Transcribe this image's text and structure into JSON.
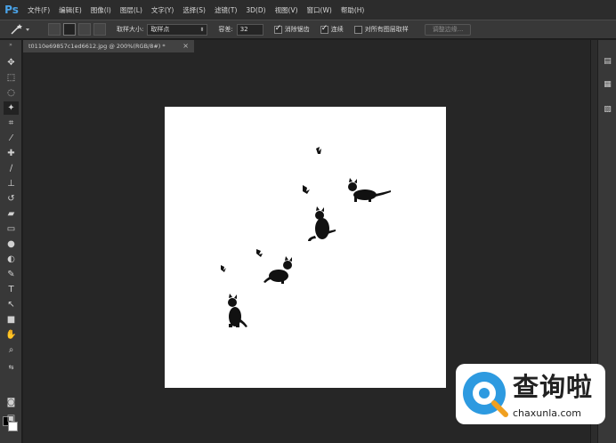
{
  "app": {
    "logo": "Ps"
  },
  "menu": [
    "文件(F)",
    "编辑(E)",
    "图像(I)",
    "图层(L)",
    "文字(Y)",
    "选择(S)",
    "滤镜(T)",
    "3D(D)",
    "视图(V)",
    "窗口(W)",
    "帮助(H)"
  ],
  "options": {
    "sample_size_label": "取样大小:",
    "sample_size_value": "取样点",
    "tolerance_label": "容差:",
    "tolerance_value": "32",
    "anti_alias_label": "消除锯齿",
    "anti_alias_checked": true,
    "contiguous_label": "连续",
    "contiguous_checked": true,
    "all_layers_label": "对所有图层取样",
    "all_layers_checked": false,
    "refine_edge_label": "调整边缘..."
  },
  "document_tab": {
    "title": "t0110e69857c1ed6612.jpg @ 200%(RGB/8#) *",
    "close": "×"
  },
  "colors": {
    "foreground": "#000000",
    "background": "#ffffff",
    "accent": "#4aa3e8"
  },
  "watermark": {
    "text": "查询啦",
    "url": "chaxunla.com"
  }
}
